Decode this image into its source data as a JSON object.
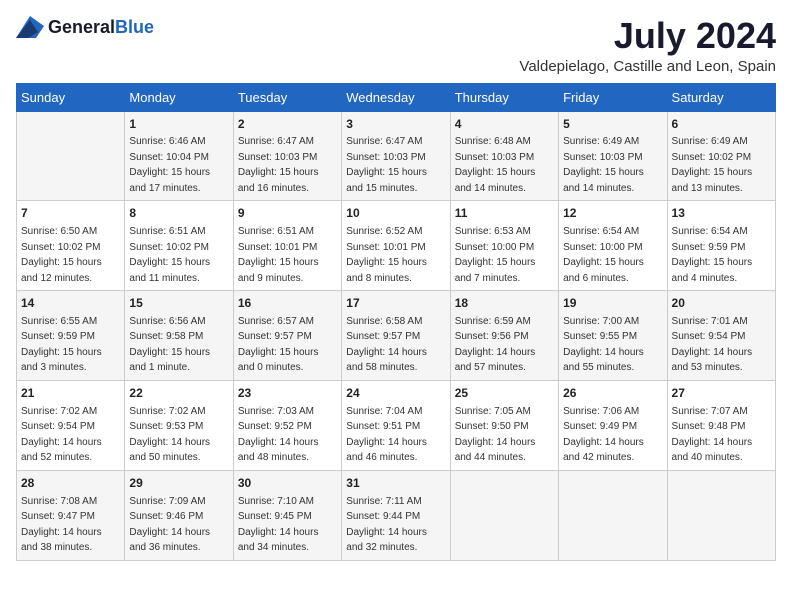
{
  "header": {
    "logo_general": "General",
    "logo_blue": "Blue",
    "month_year": "July 2024",
    "location": "Valdepielago, Castille and Leon, Spain"
  },
  "days_of_week": [
    "Sunday",
    "Monday",
    "Tuesday",
    "Wednesday",
    "Thursday",
    "Friday",
    "Saturday"
  ],
  "weeks": [
    [
      {
        "day": "",
        "sunrise": "",
        "sunset": "",
        "daylight": ""
      },
      {
        "day": "1",
        "sunrise": "Sunrise: 6:46 AM",
        "sunset": "Sunset: 10:04 PM",
        "daylight": "Daylight: 15 hours and 17 minutes."
      },
      {
        "day": "2",
        "sunrise": "Sunrise: 6:47 AM",
        "sunset": "Sunset: 10:03 PM",
        "daylight": "Daylight: 15 hours and 16 minutes."
      },
      {
        "day": "3",
        "sunrise": "Sunrise: 6:47 AM",
        "sunset": "Sunset: 10:03 PM",
        "daylight": "Daylight: 15 hours and 15 minutes."
      },
      {
        "day": "4",
        "sunrise": "Sunrise: 6:48 AM",
        "sunset": "Sunset: 10:03 PM",
        "daylight": "Daylight: 15 hours and 14 minutes."
      },
      {
        "day": "5",
        "sunrise": "Sunrise: 6:49 AM",
        "sunset": "Sunset: 10:03 PM",
        "daylight": "Daylight: 15 hours and 14 minutes."
      },
      {
        "day": "6",
        "sunrise": "Sunrise: 6:49 AM",
        "sunset": "Sunset: 10:02 PM",
        "daylight": "Daylight: 15 hours and 13 minutes."
      }
    ],
    [
      {
        "day": "7",
        "sunrise": "Sunrise: 6:50 AM",
        "sunset": "Sunset: 10:02 PM",
        "daylight": "Daylight: 15 hours and 12 minutes."
      },
      {
        "day": "8",
        "sunrise": "Sunrise: 6:51 AM",
        "sunset": "Sunset: 10:02 PM",
        "daylight": "Daylight: 15 hours and 11 minutes."
      },
      {
        "day": "9",
        "sunrise": "Sunrise: 6:51 AM",
        "sunset": "Sunset: 10:01 PM",
        "daylight": "Daylight: 15 hours and 9 minutes."
      },
      {
        "day": "10",
        "sunrise": "Sunrise: 6:52 AM",
        "sunset": "Sunset: 10:01 PM",
        "daylight": "Daylight: 15 hours and 8 minutes."
      },
      {
        "day": "11",
        "sunrise": "Sunrise: 6:53 AM",
        "sunset": "Sunset: 10:00 PM",
        "daylight": "Daylight: 15 hours and 7 minutes."
      },
      {
        "day": "12",
        "sunrise": "Sunrise: 6:54 AM",
        "sunset": "Sunset: 10:00 PM",
        "daylight": "Daylight: 15 hours and 6 minutes."
      },
      {
        "day": "13",
        "sunrise": "Sunrise: 6:54 AM",
        "sunset": "Sunset: 9:59 PM",
        "daylight": "Daylight: 15 hours and 4 minutes."
      }
    ],
    [
      {
        "day": "14",
        "sunrise": "Sunrise: 6:55 AM",
        "sunset": "Sunset: 9:59 PM",
        "daylight": "Daylight: 15 hours and 3 minutes."
      },
      {
        "day": "15",
        "sunrise": "Sunrise: 6:56 AM",
        "sunset": "Sunset: 9:58 PM",
        "daylight": "Daylight: 15 hours and 1 minute."
      },
      {
        "day": "16",
        "sunrise": "Sunrise: 6:57 AM",
        "sunset": "Sunset: 9:57 PM",
        "daylight": "Daylight: 15 hours and 0 minutes."
      },
      {
        "day": "17",
        "sunrise": "Sunrise: 6:58 AM",
        "sunset": "Sunset: 9:57 PM",
        "daylight": "Daylight: 14 hours and 58 minutes."
      },
      {
        "day": "18",
        "sunrise": "Sunrise: 6:59 AM",
        "sunset": "Sunset: 9:56 PM",
        "daylight": "Daylight: 14 hours and 57 minutes."
      },
      {
        "day": "19",
        "sunrise": "Sunrise: 7:00 AM",
        "sunset": "Sunset: 9:55 PM",
        "daylight": "Daylight: 14 hours and 55 minutes."
      },
      {
        "day": "20",
        "sunrise": "Sunrise: 7:01 AM",
        "sunset": "Sunset: 9:54 PM",
        "daylight": "Daylight: 14 hours and 53 minutes."
      }
    ],
    [
      {
        "day": "21",
        "sunrise": "Sunrise: 7:02 AM",
        "sunset": "Sunset: 9:54 PM",
        "daylight": "Daylight: 14 hours and 52 minutes."
      },
      {
        "day": "22",
        "sunrise": "Sunrise: 7:02 AM",
        "sunset": "Sunset: 9:53 PM",
        "daylight": "Daylight: 14 hours and 50 minutes."
      },
      {
        "day": "23",
        "sunrise": "Sunrise: 7:03 AM",
        "sunset": "Sunset: 9:52 PM",
        "daylight": "Daylight: 14 hours and 48 minutes."
      },
      {
        "day": "24",
        "sunrise": "Sunrise: 7:04 AM",
        "sunset": "Sunset: 9:51 PM",
        "daylight": "Daylight: 14 hours and 46 minutes."
      },
      {
        "day": "25",
        "sunrise": "Sunrise: 7:05 AM",
        "sunset": "Sunset: 9:50 PM",
        "daylight": "Daylight: 14 hours and 44 minutes."
      },
      {
        "day": "26",
        "sunrise": "Sunrise: 7:06 AM",
        "sunset": "Sunset: 9:49 PM",
        "daylight": "Daylight: 14 hours and 42 minutes."
      },
      {
        "day": "27",
        "sunrise": "Sunrise: 7:07 AM",
        "sunset": "Sunset: 9:48 PM",
        "daylight": "Daylight: 14 hours and 40 minutes."
      }
    ],
    [
      {
        "day": "28",
        "sunrise": "Sunrise: 7:08 AM",
        "sunset": "Sunset: 9:47 PM",
        "daylight": "Daylight: 14 hours and 38 minutes."
      },
      {
        "day": "29",
        "sunrise": "Sunrise: 7:09 AM",
        "sunset": "Sunset: 9:46 PM",
        "daylight": "Daylight: 14 hours and 36 minutes."
      },
      {
        "day": "30",
        "sunrise": "Sunrise: 7:10 AM",
        "sunset": "Sunset: 9:45 PM",
        "daylight": "Daylight: 14 hours and 34 minutes."
      },
      {
        "day": "31",
        "sunrise": "Sunrise: 7:11 AM",
        "sunset": "Sunset: 9:44 PM",
        "daylight": "Daylight: 14 hours and 32 minutes."
      },
      {
        "day": "",
        "sunrise": "",
        "sunset": "",
        "daylight": ""
      },
      {
        "day": "",
        "sunrise": "",
        "sunset": "",
        "daylight": ""
      },
      {
        "day": "",
        "sunrise": "",
        "sunset": "",
        "daylight": ""
      }
    ]
  ]
}
